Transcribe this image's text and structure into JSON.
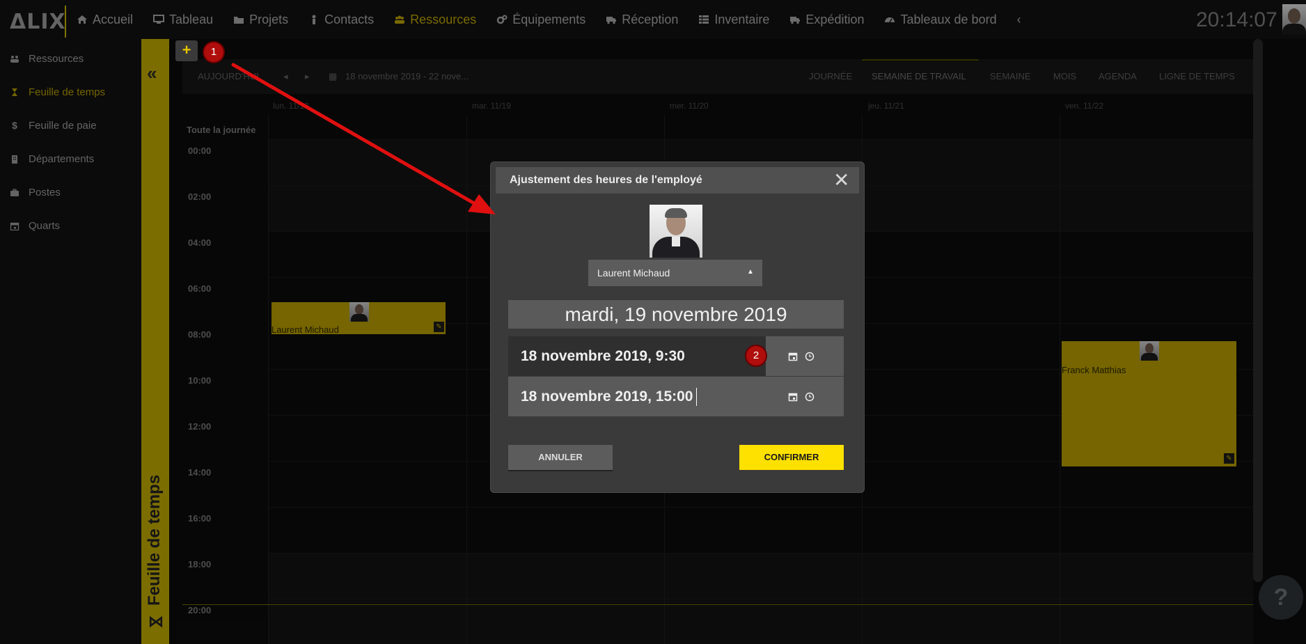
{
  "app": {
    "logo": "ΔLIX",
    "clock": "20:14:07"
  },
  "nav": [
    {
      "label": "Accueil",
      "icon": "home-icon",
      "active": false
    },
    {
      "label": "Tableau",
      "icon": "monitor-icon",
      "active": false
    },
    {
      "label": "Projets",
      "icon": "folder-icon",
      "active": false
    },
    {
      "label": "Contacts",
      "icon": "person-icon",
      "active": false
    },
    {
      "label": "Ressources",
      "icon": "users-icon",
      "active": true
    },
    {
      "label": "Équipements",
      "icon": "gears-icon",
      "active": false
    },
    {
      "label": "Réception",
      "icon": "truck-icon",
      "active": false
    },
    {
      "label": "Inventaire",
      "icon": "grid-icon",
      "active": false
    },
    {
      "label": "Expédition",
      "icon": "truck-icon",
      "active": false
    },
    {
      "label": "Tableaux de bord",
      "icon": "dashboard-icon",
      "active": false
    }
  ],
  "sidebar": {
    "items": [
      {
        "label": "Ressources",
        "icon": "users-icon"
      },
      {
        "label": "Feuille de temps",
        "icon": "hourglass-icon",
        "active": true
      },
      {
        "label": "Feuille de paie",
        "icon": "dollar-icon"
      },
      {
        "label": "Départements",
        "icon": "building-icon"
      },
      {
        "label": "Postes",
        "icon": "briefcase-icon"
      },
      {
        "label": "Quarts",
        "icon": "calendar-icon"
      }
    ],
    "vertical_title": "Feuille de temps"
  },
  "scheduler": {
    "today_label": "AUJOURD'HUI",
    "range_label": "18 novembre 2019 - 22 nove...",
    "views": [
      "JOURNÉE",
      "SEMAINE DE TRAVAIL",
      "SEMAINE",
      "MOIS",
      "AGENDA",
      "LIGNE DE TEMPS"
    ],
    "active_view": "SEMAINE DE TRAVAIL",
    "days": [
      "lun. 11/18",
      "mar. 11/19",
      "mer. 11/20",
      "jeu. 11/21",
      "ven. 11/22"
    ],
    "all_day_label": "Toute la journée",
    "times": [
      "00:00",
      "02:00",
      "04:00",
      "06:00",
      "08:00",
      "10:00",
      "12:00",
      "14:00",
      "16:00",
      "18:00",
      "20:00"
    ],
    "events": [
      {
        "name": "Laurent Michaud"
      },
      {
        "name": "Franck Matthias"
      }
    ]
  },
  "annotations": {
    "badge1": "1",
    "badge2": "2"
  },
  "modal": {
    "title": "Ajustement des heures de l'employé",
    "employee": "Laurent Michaud",
    "date_heading": "mardi, 19 novembre 2019",
    "start": "18 novembre 2019, 9:30",
    "end": "18 novembre 2019, 15:00",
    "cancel": "ANNULER",
    "confirm": "CONFIRMER"
  },
  "colors": {
    "accent": "#ffe100",
    "event": "#b59c00",
    "badge": "#b00d0d"
  }
}
